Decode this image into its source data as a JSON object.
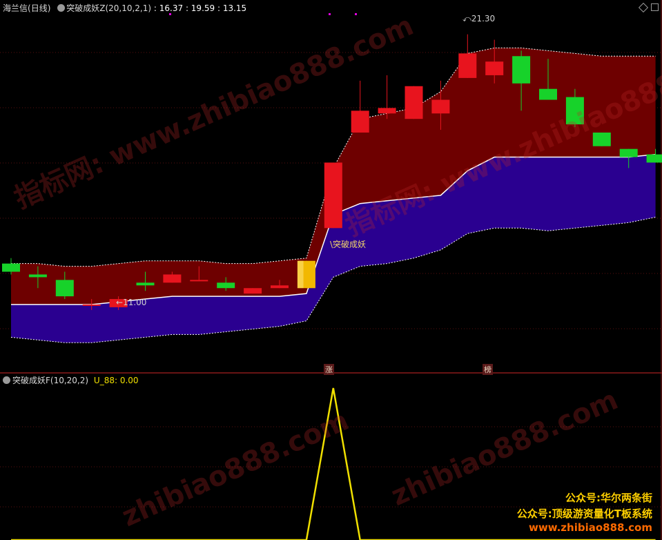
{
  "main_panel": {
    "stock_name": "海兰信",
    "period": "(日线)",
    "indicator_name": "突破成妖Z(20,10,2,1)",
    "values": [
      ": 16.37",
      ": 19.59",
      ": 13.15"
    ],
    "high_label": "21.30",
    "low_label": "11.00",
    "signal_label": "突破成妖",
    "markers": [
      "涨",
      "榜"
    ]
  },
  "sub_panel": {
    "indicator_name": "突破成妖F(10,20,2)",
    "series_label": "U_88: 0.00"
  },
  "promo": [
    "公众号:华尔两条街",
    "公众号:顶级游资量化T板系统",
    "www.zhibiao888.com"
  ],
  "watermarks": [
    "指标网: www.zhibiao888.com",
    "指标网: www.zhibiao888.com",
    "zhibiao888.com",
    "zhibiao888.com"
  ],
  "colors": {
    "up": "#e8141e",
    "down": "#17d22a",
    "upper_band": "#6e0000",
    "lower_band": "#2a0090",
    "signal_bar": "#f2b800",
    "sub_line": "#f0e000"
  },
  "chart_data": {
    "type": "candlestick",
    "candles": [
      {
        "o": 12.9,
        "c": 12.6,
        "h": 13.1,
        "l": 12.5
      },
      {
        "o": 12.5,
        "c": 12.4,
        "h": 12.8,
        "l": 12.0
      },
      {
        "o": 12.3,
        "c": 11.7,
        "h": 12.6,
        "l": 11.6
      },
      {
        "o": 11.4,
        "c": 11.4,
        "h": 11.6,
        "l": 11.2
      },
      {
        "o": 11.3,
        "c": 11.6,
        "h": 11.7,
        "l": 11.2
      },
      {
        "o": 12.2,
        "c": 12.1,
        "h": 12.6,
        "l": 11.9
      },
      {
        "o": 12.2,
        "c": 12.5,
        "h": 12.6,
        "l": 12.2
      },
      {
        "o": 12.3,
        "c": 12.3,
        "h": 12.8,
        "l": 12.3
      },
      {
        "o": 12.2,
        "c": 12.0,
        "h": 12.4,
        "l": 11.9
      },
      {
        "o": 11.8,
        "c": 12.0,
        "h": 12.0,
        "l": 11.8
      },
      {
        "o": 12.0,
        "c": 12.1,
        "h": 12.3,
        "l": 12.0
      },
      {
        "o": 12.0,
        "c": 13.0,
        "h": 13.0,
        "l": 12.0
      },
      {
        "o": 14.2,
        "c": 16.6,
        "h": 16.6,
        "l": 14.2
      },
      {
        "o": 17.7,
        "c": 18.5,
        "h": 19.6,
        "l": 17.7
      },
      {
        "o": 18.4,
        "c": 18.6,
        "h": 19.8,
        "l": 18.2
      },
      {
        "o": 18.2,
        "c": 19.4,
        "h": 19.4,
        "l": 18.2
      },
      {
        "o": 18.4,
        "c": 18.9,
        "h": 19.6,
        "l": 17.8
      },
      {
        "o": 19.7,
        "c": 20.6,
        "h": 21.3,
        "l": 19.7
      },
      {
        "o": 19.8,
        "c": 20.3,
        "h": 21.1,
        "l": 19.5
      },
      {
        "o": 20.5,
        "c": 19.5,
        "h": 20.7,
        "l": 18.5
      },
      {
        "o": 19.3,
        "c": 18.9,
        "h": 20.4,
        "l": 18.9
      },
      {
        "o": 19.0,
        "c": 18.0,
        "h": 19.3,
        "l": 17.9
      },
      {
        "o": 17.7,
        "c": 17.2,
        "h": 17.7,
        "l": 17.2
      },
      {
        "o": 17.1,
        "c": 16.8,
        "h": 17.1,
        "l": 16.4
      },
      {
        "o": 16.9,
        "c": 16.6,
        "h": 17.1,
        "l": 16.6
      }
    ],
    "signal_index": 11,
    "upper_band": [
      12.9,
      12.9,
      12.8,
      12.8,
      12.9,
      13.0,
      13.0,
      13.0,
      12.9,
      12.9,
      13.0,
      13.1,
      16.4,
      18.2,
      18.4,
      18.6,
      19.2,
      20.6,
      20.8,
      20.8,
      20.7,
      20.6,
      20.5,
      20.5,
      20.5
    ],
    "middle_line": [
      11.4,
      11.4,
      11.4,
      11.4,
      11.5,
      11.6,
      11.7,
      11.7,
      11.7,
      11.7,
      11.7,
      11.8,
      14.7,
      15.1,
      15.2,
      15.3,
      15.4,
      16.3,
      16.8,
      16.8,
      16.8,
      16.8,
      16.8,
      16.8,
      16.9
    ],
    "lower_band": [
      10.2,
      10.1,
      10.0,
      10.0,
      10.1,
      10.2,
      10.3,
      10.3,
      10.4,
      10.5,
      10.6,
      10.8,
      12.4,
      12.8,
      12.9,
      13.1,
      13.4,
      14.0,
      14.2,
      14.2,
      14.1,
      14.2,
      14.3,
      14.4,
      14.6
    ],
    "sub_values": [
      0,
      0,
      0,
      0,
      0,
      0,
      0,
      0,
      0,
      0,
      0,
      0,
      1,
      0,
      0,
      0,
      0,
      0,
      0,
      0,
      0,
      0,
      0,
      0,
      0
    ]
  }
}
